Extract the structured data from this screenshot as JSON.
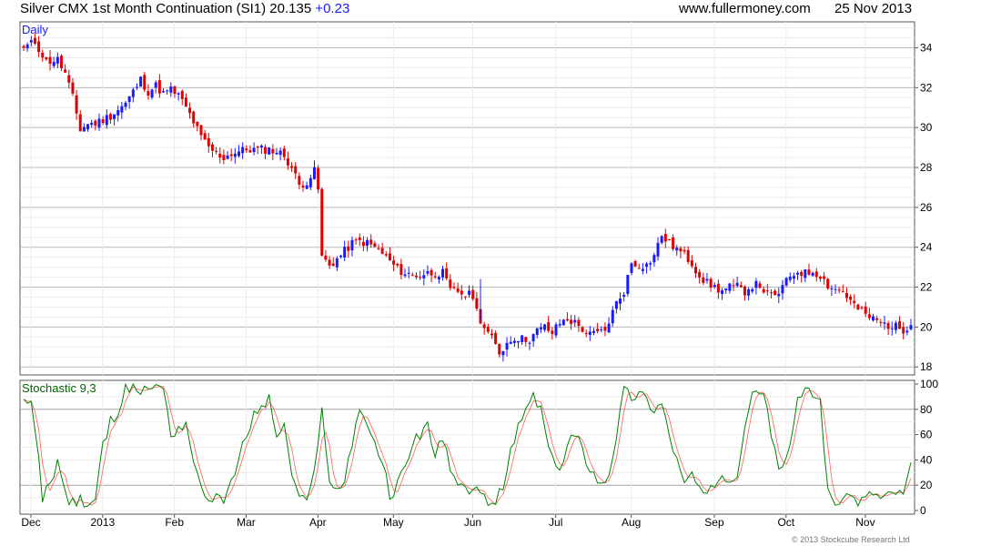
{
  "header": {
    "title": "Silver CMX 1st Month Continuation (SI1) 20.135",
    "change": "+0.23",
    "site": "www.fullermoney.com",
    "date": "25 Nov 2013"
  },
  "footer": {
    "copyright": "© 2013 Stockcube Research Ltd"
  },
  "colors": {
    "up": "#1a1aff",
    "down": "#e00000",
    "stoch_k": "#008000",
    "stoch_d": "#ff6060",
    "grid": "#c8c8c8",
    "panel_label_price": "#1a1aff",
    "panel_label_stoch": "#006400"
  },
  "chart_data": [
    {
      "type": "candlestick",
      "label": "Daily",
      "ylim": [
        17.6,
        35.3
      ],
      "y_ticks": [
        18,
        20,
        22,
        24,
        26,
        28,
        30,
        32,
        34
      ],
      "x_labels": [
        "Dec",
        "2013",
        "Feb",
        "Mar",
        "Apr",
        "May",
        "Jun",
        "Jul",
        "Aug",
        "Sep",
        "Oct",
        "Nov"
      ],
      "x_label_positions": [
        0,
        19,
        38,
        57,
        76,
        96,
        117,
        139,
        159,
        181,
        200,
        221
      ],
      "bars": 236,
      "series": [
        {
          "name": "close",
          "anchors": [
            [
              0,
              34.0
            ],
            [
              3,
              34.3
            ],
            [
              6,
              33.3
            ],
            [
              9,
              33.4
            ],
            [
              11,
              32.7
            ],
            [
              13,
              31.5
            ],
            [
              15,
              29.9
            ],
            [
              17,
              30.2
            ],
            [
              19,
              30.2
            ],
            [
              21,
              30.4
            ],
            [
              23,
              30.6
            ],
            [
              25,
              30.9
            ],
            [
              27,
              31.2
            ],
            [
              29,
              31.8
            ],
            [
              31,
              32.4
            ],
            [
              33,
              31.8
            ],
            [
              35,
              32.1
            ],
            [
              37,
              31.7
            ],
            [
              39,
              31.9
            ],
            [
              41,
              31.6
            ],
            [
              43,
              31.0
            ],
            [
              45,
              30.3
            ],
            [
              47,
              29.5
            ],
            [
              49,
              29.0
            ],
            [
              51,
              28.7
            ],
            [
              53,
              28.5
            ],
            [
              55,
              28.7
            ],
            [
              57,
              28.8
            ],
            [
              59,
              28.9
            ],
            [
              61,
              28.9
            ],
            [
              63,
              28.9
            ],
            [
              65,
              28.9
            ],
            [
              67,
              28.8
            ],
            [
              69,
              28.6
            ],
            [
              71,
              28.0
            ],
            [
              73,
              27.1
            ],
            [
              75,
              27.3
            ],
            [
              77,
              27.8
            ],
            [
              78,
              26.9
            ],
            [
              79,
              23.5
            ],
            [
              81,
              23.1
            ],
            [
              83,
              23.4
            ],
            [
              85,
              23.8
            ],
            [
              87,
              24.2
            ],
            [
              89,
              24.3
            ],
            [
              91,
              24.2
            ],
            [
              93,
              24.0
            ],
            [
              95,
              23.7
            ],
            [
              97,
              23.3
            ],
            [
              99,
              22.9
            ],
            [
              101,
              22.7
            ],
            [
              103,
              22.6
            ],
            [
              105,
              22.6
            ],
            [
              107,
              22.7
            ],
            [
              109,
              22.7
            ],
            [
              111,
              22.7
            ],
            [
              113,
              21.8
            ],
            [
              115,
              21.8
            ],
            [
              117,
              21.6
            ],
            [
              119,
              21.6
            ],
            [
              120,
              20.8
            ],
            [
              122,
              20.0
            ],
            [
              124,
              19.4
            ],
            [
              126,
              18.7
            ],
            [
              128,
              19.2
            ],
            [
              130,
              19.5
            ],
            [
              132,
              19.4
            ],
            [
              134,
              19.4
            ],
            [
              136,
              19.8
            ],
            [
              138,
              20.0
            ],
            [
              140,
              19.7
            ],
            [
              142,
              20.2
            ],
            [
              144,
              20.4
            ],
            [
              146,
              20.2
            ],
            [
              148,
              19.9
            ],
            [
              150,
              19.6
            ],
            [
              152,
              19.7
            ],
            [
              154,
              19.8
            ],
            [
              155,
              20.3
            ],
            [
              157,
              21.2
            ],
            [
              159,
              21.8
            ],
            [
              161,
              23.2
            ],
            [
              163,
              23.1
            ],
            [
              165,
              23.1
            ],
            [
              167,
              23.6
            ],
            [
              169,
              24.6
            ],
            [
              171,
              24.2
            ],
            [
              173,
              23.9
            ],
            [
              175,
              23.6
            ],
            [
              177,
              23.2
            ],
            [
              179,
              22.6
            ],
            [
              181,
              22.2
            ],
            [
              183,
              22.0
            ],
            [
              185,
              21.8
            ],
            [
              187,
              22.0
            ],
            [
              189,
              22.0
            ],
            [
              191,
              21.8
            ],
            [
              193,
              22.1
            ],
            [
              195,
              22.1
            ],
            [
              197,
              21.6
            ],
            [
              199,
              21.5
            ],
            [
              201,
              22.0
            ],
            [
              203,
              22.5
            ],
            [
              205,
              22.8
            ],
            [
              207,
              22.7
            ],
            [
              209,
              22.8
            ],
            [
              211,
              22.6
            ],
            [
              213,
              22.1
            ],
            [
              215,
              21.9
            ],
            [
              217,
              21.8
            ],
            [
              219,
              21.3
            ],
            [
              221,
              20.9
            ],
            [
              223,
              20.6
            ],
            [
              225,
              20.4
            ],
            [
              227,
              20.2
            ],
            [
              229,
              20.1
            ],
            [
              231,
              20.0
            ],
            [
              233,
              19.9
            ],
            [
              235,
              20.1
            ]
          ]
        }
      ]
    },
    {
      "type": "line",
      "label": "Stochastic 9,3",
      "ylim": [
        0,
        100
      ],
      "y_ticks": [
        0,
        20,
        40,
        60,
        80,
        100
      ],
      "series": [
        {
          "name": "%K",
          "anchors": [
            [
              0,
              88
            ],
            [
              2,
              82
            ],
            [
              4,
              45
            ],
            [
              5,
              10
            ],
            [
              7,
              22
            ],
            [
              9,
              40
            ],
            [
              11,
              12
            ],
            [
              13,
              5
            ],
            [
              15,
              8
            ],
            [
              17,
              5
            ],
            [
              19,
              10
            ],
            [
              21,
              50
            ],
            [
              23,
              70
            ],
            [
              25,
              80
            ],
            [
              27,
              95
            ],
            [
              29,
              98
            ],
            [
              31,
              95
            ],
            [
              33,
              98
            ],
            [
              35,
              97
            ],
            [
              37,
              99
            ],
            [
              39,
              60
            ],
            [
              41,
              65
            ],
            [
              43,
              70
            ],
            [
              45,
              40
            ],
            [
              47,
              15
            ],
            [
              49,
              10
            ],
            [
              51,
              12
            ],
            [
              53,
              10
            ],
            [
              55,
              20
            ],
            [
              57,
              40
            ],
            [
              59,
              60
            ],
            [
              61,
              75
            ],
            [
              63,
              82
            ],
            [
              65,
              88
            ],
            [
              67,
              60
            ],
            [
              69,
              65
            ],
            [
              71,
              30
            ],
            [
              73,
              10
            ],
            [
              75,
              5
            ],
            [
              77,
              30
            ],
            [
              79,
              85
            ],
            [
              81,
              20
            ],
            [
              83,
              15
            ],
            [
              85,
              25
            ],
            [
              87,
              55
            ],
            [
              89,
              80
            ],
            [
              91,
              70
            ],
            [
              93,
              50
            ],
            [
              95,
              40
            ],
            [
              97,
              10
            ],
            [
              99,
              20
            ],
            [
              101,
              35
            ],
            [
              103,
              55
            ],
            [
              105,
              60
            ],
            [
              107,
              70
            ],
            [
              109,
              40
            ],
            [
              111,
              60
            ],
            [
              113,
              30
            ],
            [
              115,
              20
            ],
            [
              117,
              15
            ],
            [
              119,
              20
            ],
            [
              121,
              10
            ],
            [
              123,
              8
            ],
            [
              125,
              5
            ],
            [
              127,
              20
            ],
            [
              129,
              45
            ],
            [
              131,
              65
            ],
            [
              133,
              80
            ],
            [
              135,
              90
            ],
            [
              137,
              80
            ],
            [
              139,
              50
            ],
            [
              141,
              30
            ],
            [
              143,
              40
            ],
            [
              145,
              60
            ],
            [
              147,
              55
            ],
            [
              149,
              40
            ],
            [
              151,
              30
            ],
            [
              153,
              20
            ],
            [
              155,
              30
            ],
            [
              157,
              60
            ],
            [
              159,
              95
            ],
            [
              161,
              90
            ],
            [
              163,
              92
            ],
            [
              165,
              88
            ],
            [
              167,
              80
            ],
            [
              169,
              85
            ],
            [
              171,
              60
            ],
            [
              173,
              40
            ],
            [
              175,
              20
            ],
            [
              177,
              30
            ],
            [
              179,
              15
            ],
            [
              181,
              10
            ],
            [
              183,
              20
            ],
            [
              185,
              30
            ],
            [
              187,
              25
            ],
            [
              189,
              30
            ],
            [
              191,
              70
            ],
            [
              193,
              97
            ],
            [
              195,
              95
            ],
            [
              197,
              80
            ],
            [
              199,
              45
            ],
            [
              201,
              30
            ],
            [
              203,
              55
            ],
            [
              205,
              85
            ],
            [
              207,
              95
            ],
            [
              209,
              92
            ],
            [
              211,
              88
            ],
            [
              213,
              15
            ],
            [
              215,
              8
            ],
            [
              217,
              5
            ],
            [
              219,
              12
            ],
            [
              221,
              8
            ],
            [
              223,
              10
            ],
            [
              225,
              15
            ],
            [
              227,
              10
            ],
            [
              229,
              12
            ],
            [
              231,
              15
            ],
            [
              233,
              12
            ],
            [
              235,
              38
            ]
          ]
        },
        {
          "name": "%D",
          "smoothing": 3
        }
      ]
    }
  ]
}
